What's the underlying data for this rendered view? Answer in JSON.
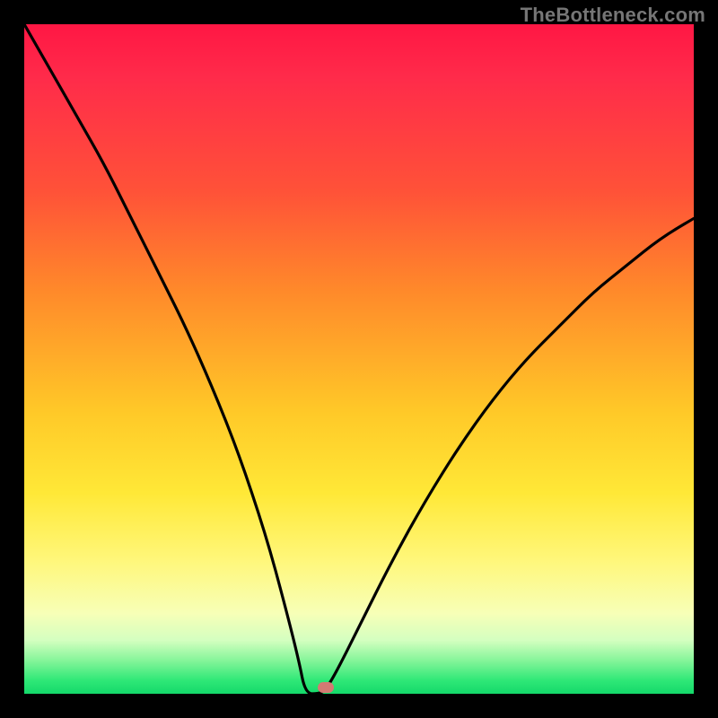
{
  "watermark": "TheBottleneck.com",
  "colors": {
    "frame_bg": "#000000",
    "curve_stroke": "#000000",
    "marker_fill": "#d37a73",
    "gradient_stops": [
      "#ff1744",
      "#ff2b4a",
      "#ff5238",
      "#ff8a2a",
      "#ffc928",
      "#ffe837",
      "#fff77a",
      "#f7ffb7",
      "#d4ffc0",
      "#86f59a",
      "#2fe877",
      "#14d96a"
    ]
  },
  "chart_data": {
    "type": "line",
    "title": "",
    "xlabel": "",
    "ylabel": "",
    "xlim": [
      0,
      100
    ],
    "ylim": [
      0,
      100
    ],
    "note": "x is horizontal position as % of plot width; y is curve value as % of plot height (0 = bottom/green, 100 = top/red). Curve touches 0 near x≈42–45, rising steeply on both sides.",
    "series": [
      {
        "name": "bottleneck-curve",
        "x": [
          0,
          4,
          8,
          12,
          16,
          20,
          24,
          28,
          32,
          36,
          39,
          41,
          42,
          44,
          45,
          47,
          50,
          55,
          60,
          65,
          70,
          75,
          80,
          85,
          90,
          95,
          100
        ],
        "y": [
          100,
          93,
          86,
          79,
          71,
          63,
          55,
          46,
          36,
          24,
          13,
          5,
          0,
          0,
          0.5,
          4,
          10,
          20,
          29,
          37,
          44,
          50,
          55,
          60,
          64,
          68,
          71
        ]
      }
    ],
    "marker": {
      "x_pct": 45.0,
      "y_pct": 0.5
    }
  }
}
